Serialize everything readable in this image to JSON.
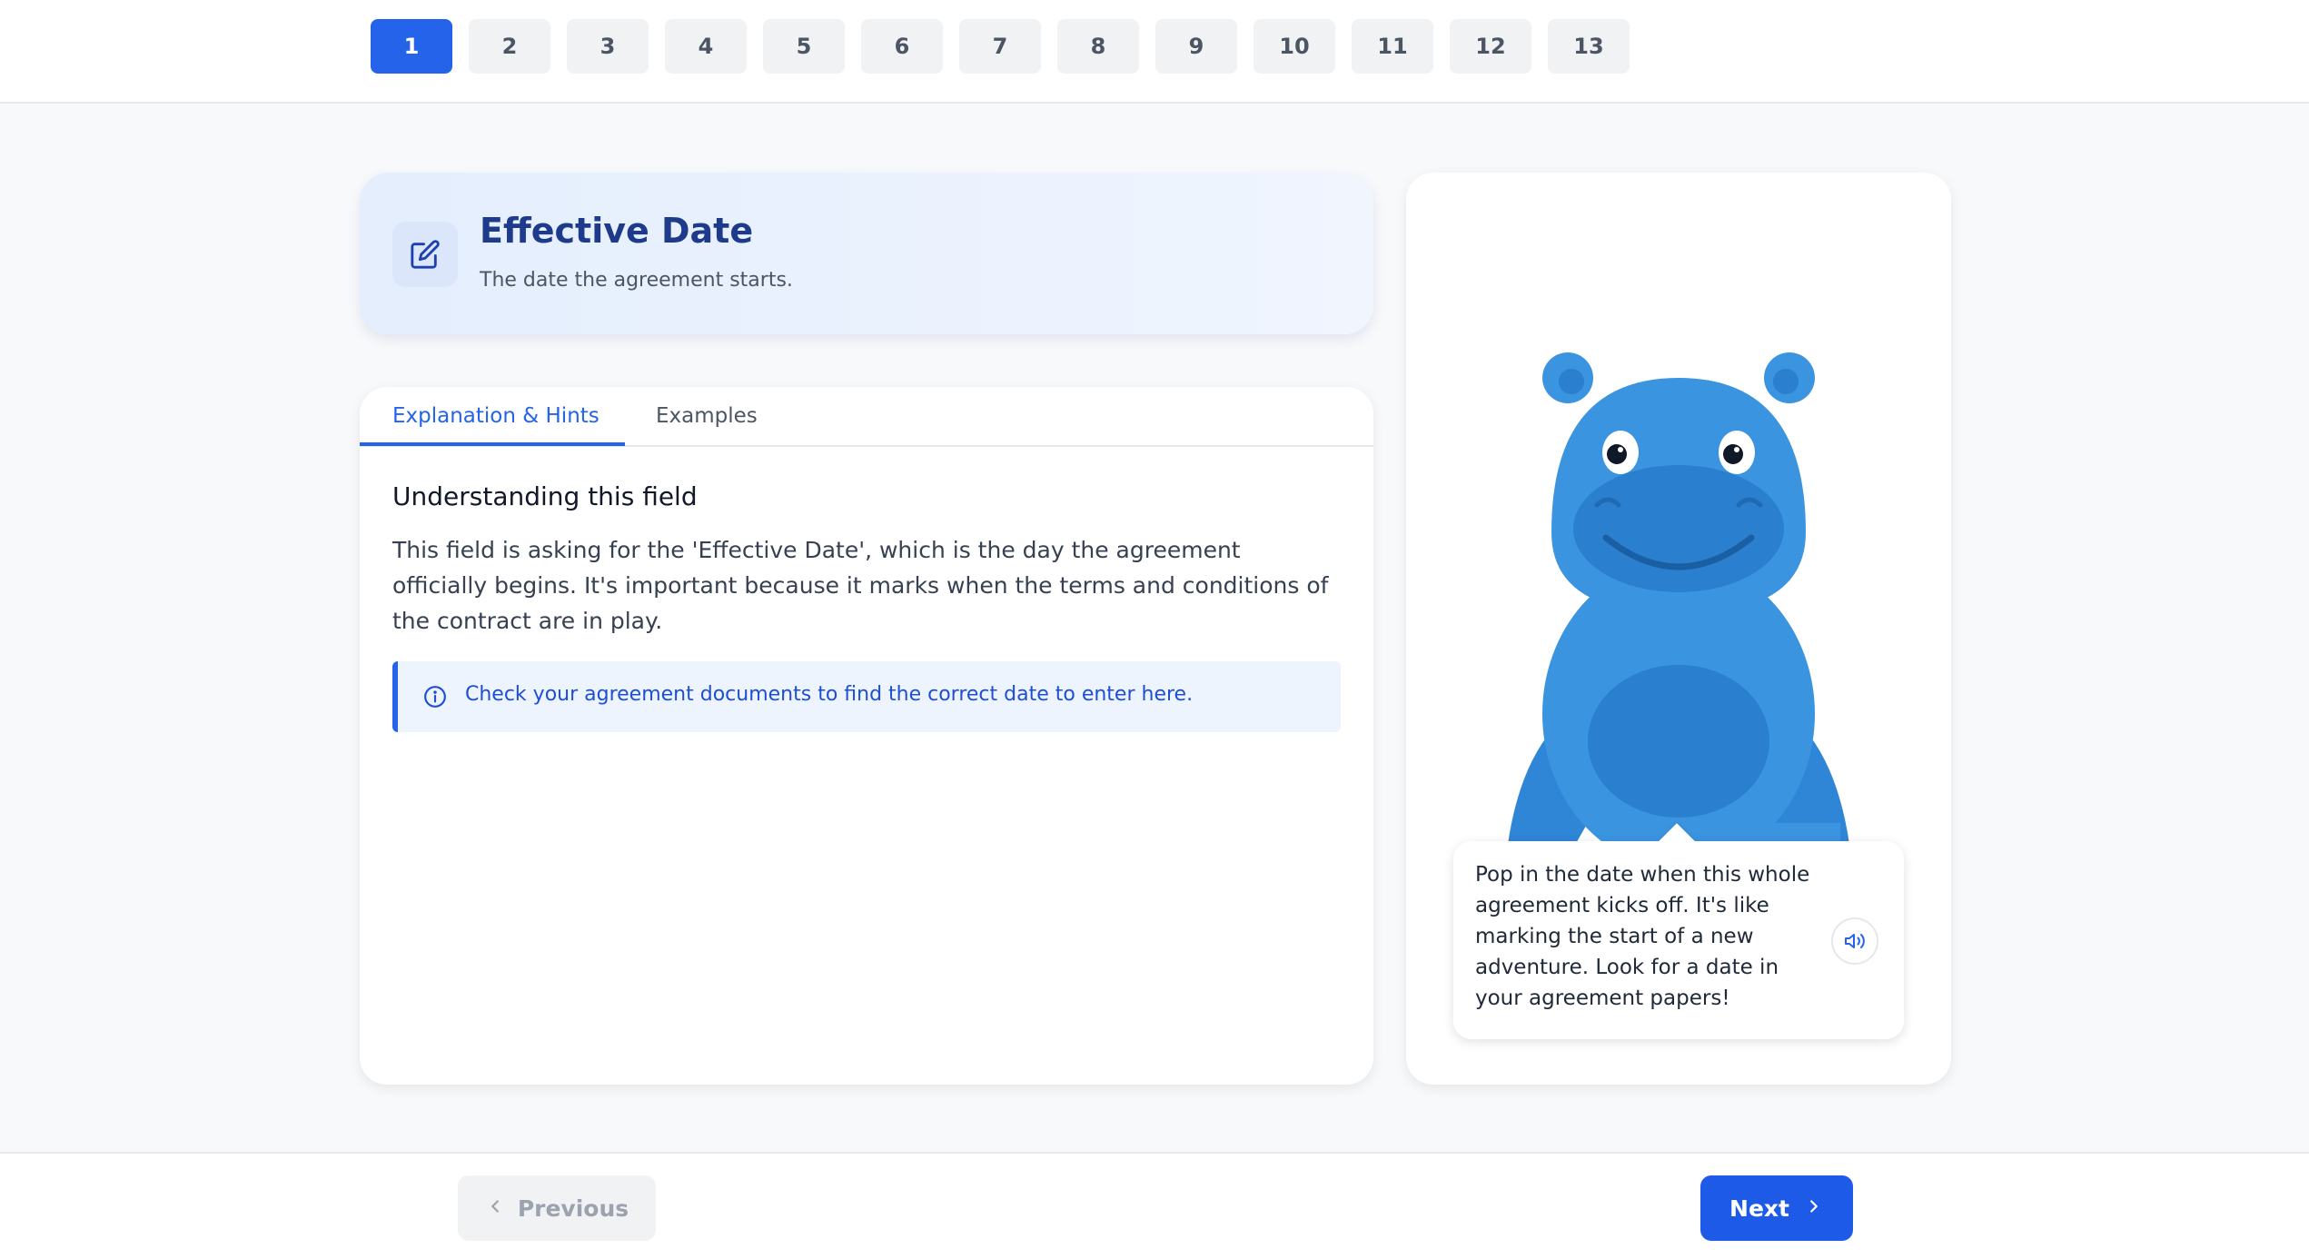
{
  "steps": {
    "items": [
      "1",
      "2",
      "3",
      "4",
      "5",
      "6",
      "7",
      "8",
      "9",
      "10",
      "11",
      "12",
      "13"
    ],
    "active_index": 0
  },
  "header": {
    "icon": "edit-icon",
    "title": "Effective Date",
    "subtitle": "The date the agreement starts."
  },
  "tabs": {
    "items": [
      {
        "label": "Explanation & Hints",
        "active": true
      },
      {
        "label": "Examples",
        "active": false
      }
    ]
  },
  "explanation": {
    "title": "Understanding this field",
    "body": "This field is asking for the 'Effective Date', which is the day the agreement officially begins. It's important because it marks when the terms and conditions of the contract are in play.",
    "hint_icon": "info-icon",
    "hint": "Check your agreement documents to find the correct date to enter here."
  },
  "mascot": {
    "character": "hippo",
    "speech": "Pop in the date when this whole agreement kicks off. It's like marking the start of a new adventure. Look for a date in your agreement papers!",
    "speaker_icon": "speaker-icon"
  },
  "footer": {
    "previous_label": "Previous",
    "next_label": "Next"
  },
  "colors": {
    "accent": "#2563eb",
    "header_title": "#1e3a8a",
    "hippo_body": "#3b94e0",
    "hippo_dark": "#2a7fcf"
  }
}
